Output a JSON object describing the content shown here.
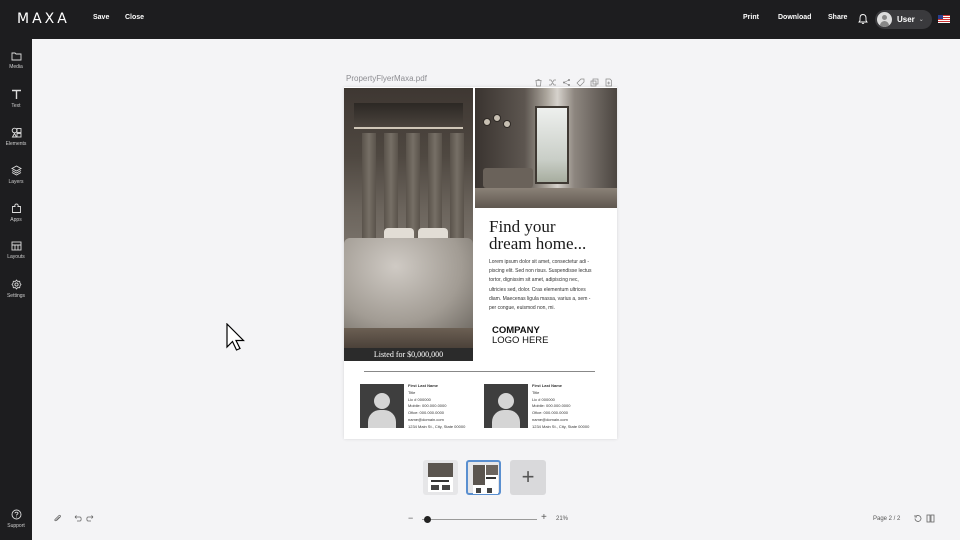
{
  "app": {
    "logo": "MAXA",
    "actions": {
      "save": "Save",
      "close": "Close"
    },
    "right_actions": {
      "print": "Print",
      "download": "Download",
      "share": "Share"
    },
    "user": "User",
    "user_chevron": "⌄"
  },
  "sidebar": {
    "items": [
      {
        "label": "Media",
        "icon": "folder-icon"
      },
      {
        "label": "Text",
        "icon": "text-icon"
      },
      {
        "label": "Elements",
        "icon": "elements-icon"
      },
      {
        "label": "Layers",
        "icon": "layers-icon"
      },
      {
        "label": "Apps",
        "icon": "apps-icon"
      },
      {
        "label": "Layouts",
        "icon": "layouts-icon"
      },
      {
        "label": "Settings",
        "icon": "gear-icon"
      }
    ],
    "support": "Support"
  },
  "document": {
    "filename": "PropertyFlyerMaxa.pdf",
    "flyer": {
      "listed": "Listed for $0,000,000",
      "headline_1": "Find your",
      "headline_2": "dream home...",
      "body": "Lorem ipsum dolor sit amet, consectetur adi - piscing elit. Sed non risus. Suspendisse lectus tortor, dignissim sit amet, adipiscing nec, ultricies sed, dolor. Cras elementum ultrices diam. Maecenas ligula massa, varius a, sem - per congue, euismod non, mi.",
      "logo_line_1": "COMPANY",
      "logo_line_2": "LOGO HERE",
      "agents": [
        {
          "name": "First Last Name",
          "title": "Title",
          "lic": "Lic #  000000",
          "mobile": "Mobile:  000.000.0000",
          "office": "Ofice:    000.000.0000",
          "email": "name@domain.com",
          "address": "1234 Main St., City, State 00000"
        },
        {
          "name": "First Last Name",
          "title": "Title",
          "lic": "Lic #  000000",
          "mobile": "Mobile:  000.000.0000",
          "office": "Ofice:    000.000.0000",
          "email": "name@domain.com",
          "address": "1234 Main St., City, State 00000"
        }
      ]
    }
  },
  "pages": {
    "add": "+"
  },
  "bottom_bar": {
    "zoom": "21%",
    "zoom_fraction": 0.05,
    "page_indicator": "Page 2 / 2"
  },
  "colors": {
    "chrome": "#1d1d1f",
    "canvas": "#f4f4f6",
    "selected_page": "#5a8fd0"
  }
}
